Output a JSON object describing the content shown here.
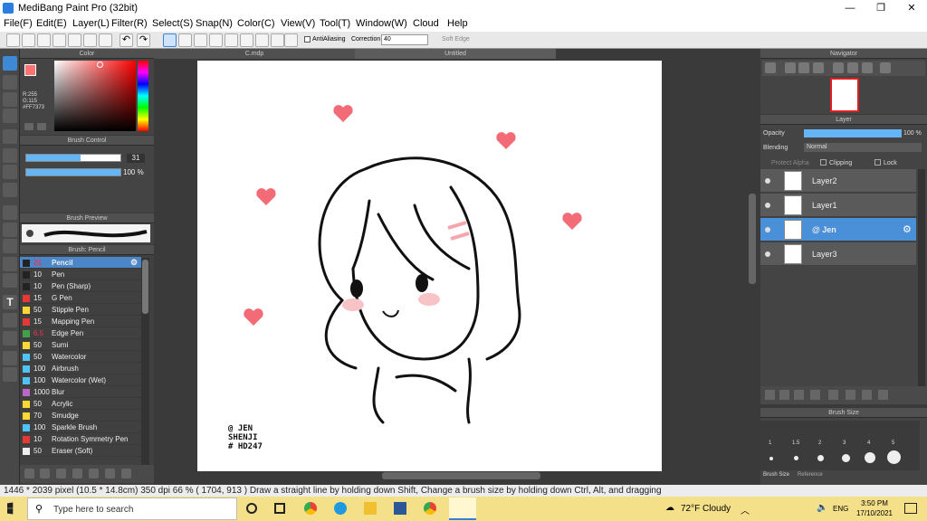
{
  "window": {
    "title": "MediBang Paint Pro (32bit)",
    "minimize": "—",
    "maximize": "❐",
    "close": "✕"
  },
  "menu": [
    "File(F)",
    "Edit(E)",
    "Layer(L)",
    "Filter(R)",
    "Select(S)",
    "Snap(N)",
    "Color(C)",
    "View(V)",
    "Tool(T)",
    "Window(W)",
    "Cloud",
    "Help"
  ],
  "toolbar": {
    "antialiasing": "AntiAliasing",
    "correction_label": "Correction",
    "correction_value": "40",
    "soft_edge": "Soft Edge"
  },
  "tabs": {
    "left": "C.mdp",
    "right": "Untitled"
  },
  "color_panel": {
    "title": "Color",
    "r": "R:255",
    "g": "G:115",
    "hex": "#FF7373",
    "primary": "#ff7373"
  },
  "brush_control": {
    "title": "Brush Control",
    "size": "31",
    "opacity": "100 %"
  },
  "brush_preview": {
    "title": "Brush Preview"
  },
  "brush_panel": {
    "title": "Brush: Pencil",
    "items": [
      {
        "size": "31",
        "name": "Pencil",
        "color": "#222"
      },
      {
        "size": "10",
        "name": "Pen",
        "color": "#222"
      },
      {
        "size": "10",
        "name": "Pen (Sharp)",
        "color": "#222"
      },
      {
        "size": "15",
        "name": "G Pen",
        "color": "#e53935"
      },
      {
        "size": "50",
        "name": "Stipple Pen",
        "color": "#fdd835"
      },
      {
        "size": "15",
        "name": "Mapping Pen",
        "color": "#e53935"
      },
      {
        "size": "6.5",
        "name": "Edge Pen",
        "color": "#43a047"
      },
      {
        "size": "50",
        "name": "Sumi",
        "color": "#fdd835"
      },
      {
        "size": "50",
        "name": "Watercolor",
        "color": "#4fc3f7"
      },
      {
        "size": "100",
        "name": "Airbrush",
        "color": "#4fc3f7"
      },
      {
        "size": "100",
        "name": "Watercolor (Wet)",
        "color": "#4fc3f7"
      },
      {
        "size": "1000",
        "name": "Blur",
        "color": "#ba68c8"
      },
      {
        "size": "50",
        "name": "Acrylic",
        "color": "#fdd835"
      },
      {
        "size": "70",
        "name": "Smudge",
        "color": "#fdd835"
      },
      {
        "size": "100",
        "name": "Sparkle Brush",
        "color": "#4fc3f7"
      },
      {
        "size": "10",
        "name": "Rotation Symmetry Pen",
        "color": "#e53935"
      },
      {
        "size": "50",
        "name": "Eraser (Soft)",
        "color": "#eeeeee"
      }
    ]
  },
  "navigator": {
    "title": "Navigator"
  },
  "layer_panel": {
    "title": "Layer",
    "opacity_label": "Opacity",
    "opacity_value": "100 %",
    "blending_label": "Blending",
    "blending_value": "Normal",
    "protect_alpha": "Protect Alpha",
    "clipping": "Clipping",
    "lock": "Lock",
    "layers": [
      {
        "name": "Layer2"
      },
      {
        "name": "Layer1"
      },
      {
        "name": "@ Jen",
        "selected": true
      },
      {
        "name": "Layer3"
      }
    ]
  },
  "brush_size": {
    "title": "Brush Size",
    "labels": [
      "1",
      "1.5",
      "2",
      "3",
      "4",
      "5"
    ],
    "tabs": [
      "Brush Size",
      "Reference"
    ]
  },
  "canvas": {
    "signature": [
      "@ JEN",
      "SHENJI",
      "# HD247"
    ]
  },
  "status": {
    "text": "1446 * 2039 pixel  (10.5 * 14.8cm)  350 dpi  66 %  ( 1704, 913 )  Draw a straight line by holding down Shift, Change a brush size by holding down Ctrl, Alt, and dragging"
  },
  "taskbar": {
    "search": "Type here to search",
    "weather": "72°F Cloudy",
    "lang": "ENG",
    "time": "3:50 PM",
    "date": "17/10/2021"
  }
}
